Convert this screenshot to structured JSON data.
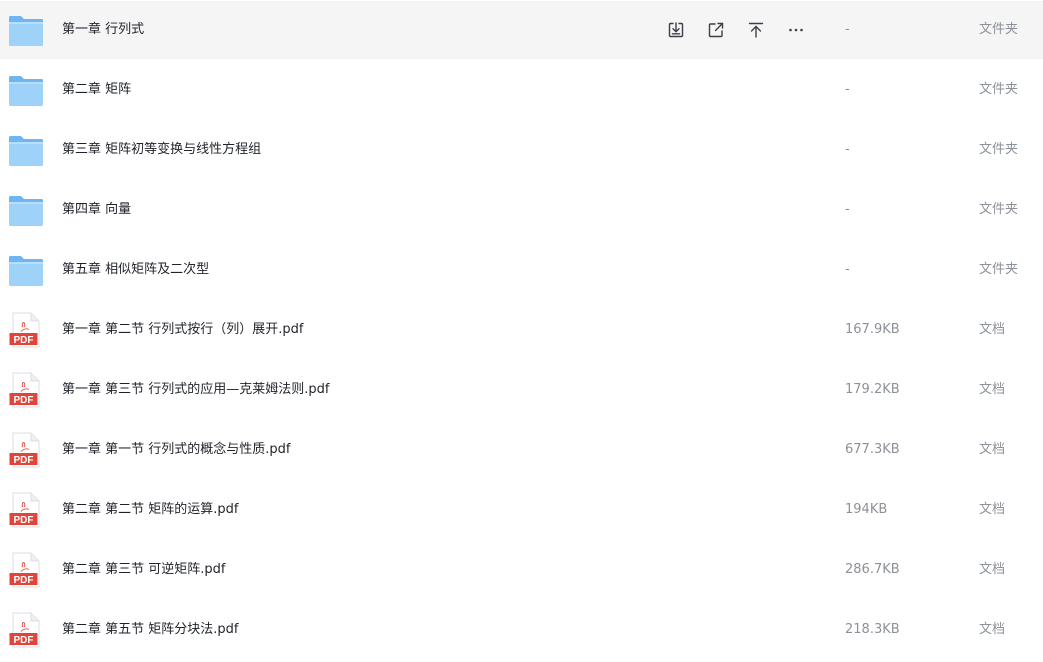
{
  "icons": {
    "folder": "folder-icon",
    "pdf": "pdf-file-icon",
    "download": "download-icon",
    "share": "share-icon",
    "move_top": "move-to-top-icon",
    "more": "more-icon"
  },
  "colors": {
    "folder_light": "#9fd2f9",
    "folder_dark": "#6fb6f0",
    "pdf_red": "#e0453a",
    "hover_bg": "#f5f5f6",
    "name_text": "#1f2329",
    "meta_text": "#8d9198"
  },
  "pdf_badge_label": "PDF",
  "files": [
    {
      "name": "第一章 行列式",
      "size": "-",
      "type": "文件夹",
      "kind": "folder"
    },
    {
      "name": "第二章 矩阵",
      "size": "-",
      "type": "文件夹",
      "kind": "folder"
    },
    {
      "name": "第三章 矩阵初等变换与线性方程组",
      "size": "-",
      "type": "文件夹",
      "kind": "folder"
    },
    {
      "name": "第四章 向量",
      "size": "-",
      "type": "文件夹",
      "kind": "folder"
    },
    {
      "name": "第五章 相似矩阵及二次型",
      "size": "-",
      "type": "文件夹",
      "kind": "folder"
    },
    {
      "name": "第一章 第二节  行列式按行（列）展开.pdf",
      "size": "167.9KB",
      "type": "文档",
      "kind": "pdf"
    },
    {
      "name": "第一章 第三节  行列式的应用—克莱姆法则.pdf",
      "size": "179.2KB",
      "type": "文档",
      "kind": "pdf"
    },
    {
      "name": "第一章 第一节  行列式的概念与性质.pdf",
      "size": "677.3KB",
      "type": "文档",
      "kind": "pdf"
    },
    {
      "name": "第二章 第二节  矩阵的运算.pdf",
      "size": "194KB",
      "type": "文档",
      "kind": "pdf"
    },
    {
      "name": "第二章 第三节  可逆矩阵.pdf",
      "size": "286.7KB",
      "type": "文档",
      "kind": "pdf"
    },
    {
      "name": "第二章 第五节  矩阵分块法.pdf",
      "size": "218.3KB",
      "type": "文档",
      "kind": "pdf"
    }
  ]
}
